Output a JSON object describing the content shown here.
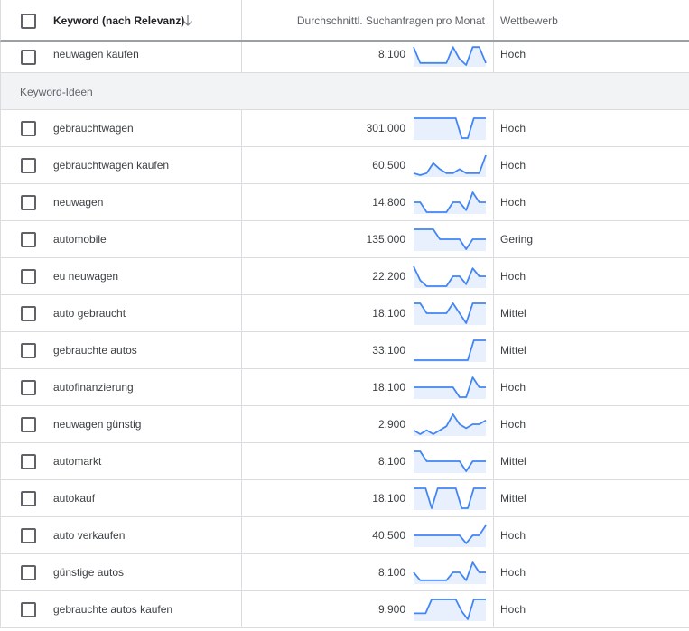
{
  "header": {
    "keyword": "Keyword (nach Relevanz)",
    "searches": "Durchschnittl. Suchanfragen pro Monat",
    "competition": "Wettbewerb"
  },
  "top_row": {
    "keyword": "neuwagen kaufen",
    "volume": "8.100",
    "competition": "Hoch",
    "trend": [
      0.9,
      0.1,
      0.1,
      0.1,
      0.1,
      0.1,
      0.9,
      0.3,
      0.0,
      0.9,
      0.9,
      0.1
    ]
  },
  "section_label": "Keyword-Ideen",
  "rows": [
    {
      "keyword": "gebrauchtwagen",
      "volume": "301.000",
      "competition": "Hoch",
      "trend": [
        1,
        1,
        1,
        1,
        1,
        1,
        1,
        1,
        0,
        0,
        1,
        1,
        1
      ]
    },
    {
      "keyword": "gebrauchtwagen kaufen",
      "volume": "60.500",
      "competition": "Hoch",
      "trend": [
        0.1,
        0.0,
        0.1,
        0.6,
        0.3,
        0.1,
        0.1,
        0.3,
        0.1,
        0.1,
        0.1,
        1.0
      ]
    },
    {
      "keyword": "neuwagen",
      "volume": "14.800",
      "competition": "Hoch",
      "trend": [
        0.5,
        0.5,
        0.0,
        0.0,
        0.0,
        0.0,
        0.5,
        0.5,
        0.1,
        1.0,
        0.5,
        0.5
      ]
    },
    {
      "keyword": "automobile",
      "volume": "135.000",
      "competition": "Gering",
      "trend": [
        1,
        1,
        1,
        1,
        0.5,
        0.5,
        0.5,
        0.5,
        0.0,
        0.5,
        0.5,
        0.5
      ]
    },
    {
      "keyword": "eu neuwagen",
      "volume": "22.200",
      "competition": "Hoch",
      "trend": [
        1.0,
        0.3,
        0.0,
        0.0,
        0.0,
        0.0,
        0.5,
        0.5,
        0.1,
        0.9,
        0.5,
        0.5
      ]
    },
    {
      "keyword": "auto gebraucht",
      "volume": "18.100",
      "competition": "Mittel",
      "trend": [
        1,
        1,
        0.5,
        0.5,
        0.5,
        0.5,
        1,
        0.5,
        0,
        1,
        1,
        1
      ]
    },
    {
      "keyword": "gebrauchte autos",
      "volume": "33.100",
      "competition": "Mittel",
      "trend": [
        0,
        0,
        0,
        0,
        0,
        0,
        0,
        0,
        0,
        0,
        1,
        1,
        1
      ]
    },
    {
      "keyword": "autofinanzierung",
      "volume": "18.100",
      "competition": "Hoch",
      "trend": [
        0.5,
        0.5,
        0.5,
        0.5,
        0.5,
        0.5,
        0.5,
        0.0,
        0.0,
        1.0,
        0.5,
        0.5
      ]
    },
    {
      "keyword": "neuwagen günstig",
      "volume": "2.900",
      "competition": "Hoch",
      "trend": [
        0.2,
        0.0,
        0.2,
        0.0,
        0.2,
        0.4,
        1.0,
        0.5,
        0.3,
        0.5,
        0.5,
        0.7
      ]
    },
    {
      "keyword": "automarkt",
      "volume": "8.100",
      "competition": "Mittel",
      "trend": [
        1,
        1,
        0.5,
        0.5,
        0.5,
        0.5,
        0.5,
        0.5,
        0.0,
        0.5,
        0.5,
        0.5
      ]
    },
    {
      "keyword": "autokauf",
      "volume": "18.100",
      "competition": "Mittel",
      "trend": [
        1,
        1,
        1,
        0,
        1,
        1,
        1,
        1,
        0,
        0,
        1,
        1,
        1
      ]
    },
    {
      "keyword": "auto verkaufen",
      "volume": "40.500",
      "competition": "Hoch",
      "trend": [
        0.5,
        0.5,
        0.5,
        0.5,
        0.5,
        0.5,
        0.5,
        0.5,
        0.1,
        0.5,
        0.5,
        1.0
      ]
    },
    {
      "keyword": "günstige autos",
      "volume": "8.100",
      "competition": "Hoch",
      "trend": [
        0.5,
        0.1,
        0.1,
        0.1,
        0.1,
        0.1,
        0.5,
        0.5,
        0.1,
        1.0,
        0.5,
        0.5
      ]
    },
    {
      "keyword": "gebrauchte autos kaufen",
      "volume": "9.900",
      "competition": "Hoch",
      "trend": [
        0.3,
        0.3,
        0.3,
        1,
        1,
        1,
        1,
        1,
        0.4,
        0,
        1,
        1,
        1
      ]
    }
  ],
  "colors": {
    "line": "#4285f4",
    "fill": "#e8f0fe"
  },
  "icons": {
    "sort": "arrow-down-icon",
    "checkbox": "checkbox-icon"
  }
}
